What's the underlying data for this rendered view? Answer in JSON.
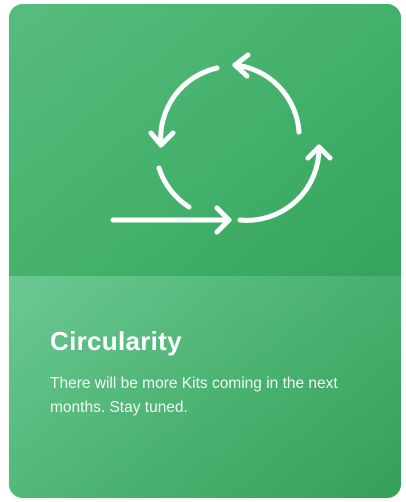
{
  "card": {
    "title": "Circularity",
    "description": "There will be more Kits coming in the next months. Stay tuned.",
    "icon": "circular-arrows-icon"
  },
  "colors": {
    "card_green": "#45b16d",
    "card_green_light": "#6cc893",
    "card_green_dark": "#2f9d56",
    "text": "#ffffff"
  }
}
